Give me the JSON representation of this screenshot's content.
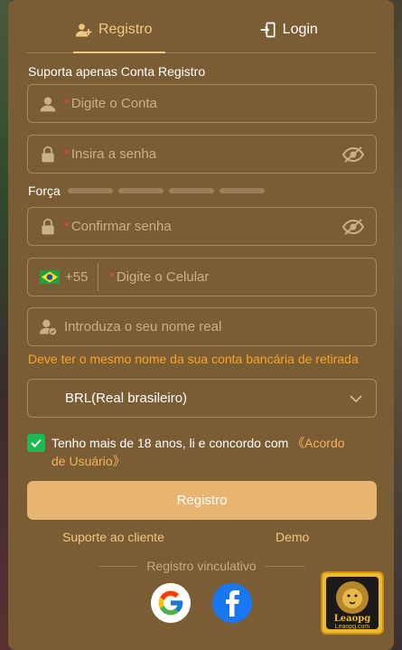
{
  "tabs": [
    {
      "label": "Registro",
      "active": true,
      "icon": "add-user-icon"
    },
    {
      "label": "Login",
      "active": false,
      "icon": "login-door-icon"
    }
  ],
  "notice": "Suporta apenas Conta Registro",
  "account_field": {
    "required_mark": "*",
    "placeholder": "Digite o Conta",
    "icon": "user-icon"
  },
  "password_field": {
    "required_mark": "*",
    "placeholder": "Insira a senha",
    "icon": "lock-icon",
    "toggle_icon": "eye-off-icon"
  },
  "strength": {
    "label": "Força",
    "segments": 4,
    "filled": 0
  },
  "confirm_field": {
    "required_mark": "*",
    "placeholder": "Confirmar senha",
    "icon": "lock-icon",
    "toggle_icon": "eye-off-icon"
  },
  "phone_field": {
    "flag": "brazil-flag-icon",
    "country_code": "+55",
    "required_mark": "*",
    "placeholder": "Digite o Celular"
  },
  "realname_field": {
    "placeholder": "Introduza o seu nome real",
    "icon": "user-check-icon"
  },
  "realname_hint": "Deve ter o mesmo nome da sua conta bancária de retirada",
  "currency_select": {
    "value": "BRL(Real brasileiro)",
    "icon": "chevron-down-icon"
  },
  "agreement": {
    "checked": true,
    "text": "Tenho mais de 18 anos, li e concordo com ",
    "link": "《Acordo de Usuário》"
  },
  "submit_label": "Registro",
  "support_link": "Suporte ao cliente",
  "demo_link": "Demo",
  "bind_label": "Registro vinculativo",
  "social": [
    "google-icon",
    "facebook-icon"
  ],
  "logo": {
    "name": "Leaopg",
    "url": "Leaopg.com"
  },
  "colors": {
    "panel": "#7a5d35",
    "accent": "#f3c77e",
    "button": "#e9b472",
    "hint": "#f6a52a",
    "required": "#e8453c",
    "check": "#1db954"
  }
}
